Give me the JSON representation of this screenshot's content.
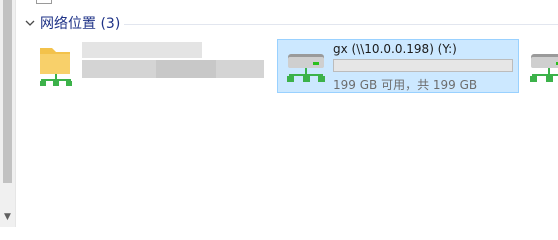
{
  "group": {
    "title": "网络位置 (3)",
    "expanded": true
  },
  "items": [
    {
      "name": "",
      "icon": "network-folder-icon",
      "blurred": true
    },
    {
      "name": "gx (\\\\10.0.0.198) (Y:)",
      "icon": "network-drive-icon",
      "selected": true,
      "used_fraction": 0.0,
      "space_text": "199 GB 可用，共 199 GB"
    },
    {
      "name": "",
      "icon": "network-drive-icon",
      "partial": true
    }
  ],
  "colors": {
    "group_title": "#1e3287",
    "selection_fill": "#cce8ff",
    "selection_border": "#99d1ff",
    "usage_fill": "#26a0da",
    "network_green": "#3cb24a"
  }
}
